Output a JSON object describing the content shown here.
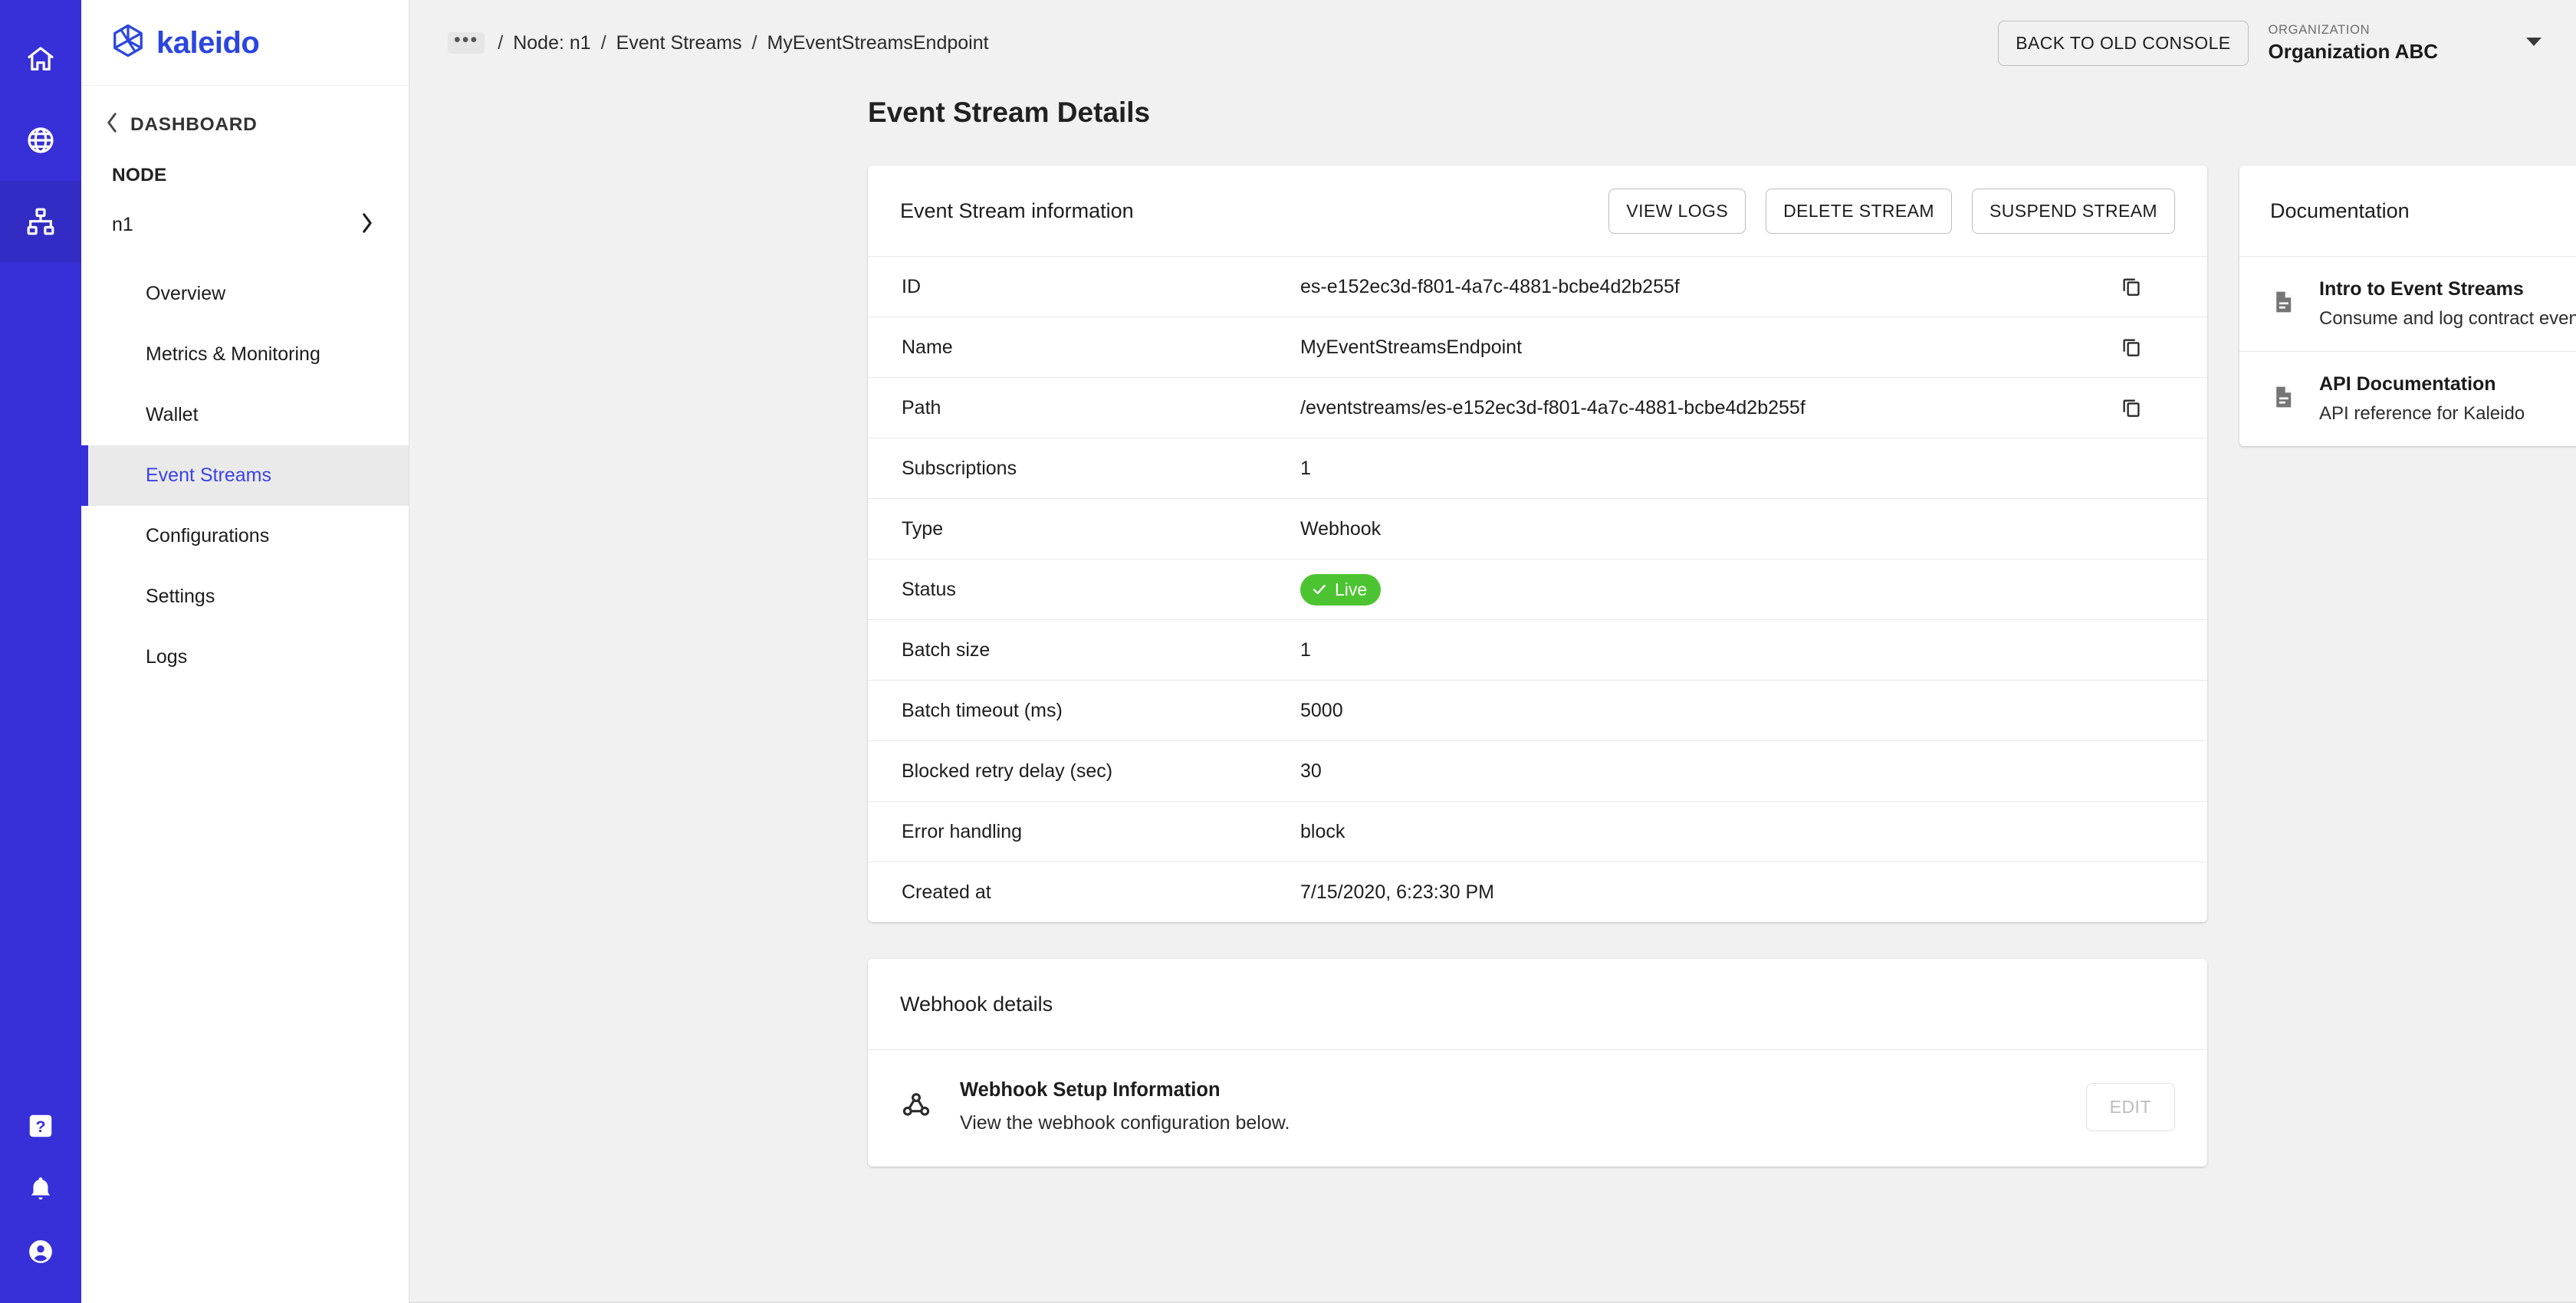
{
  "rail": {
    "items": [
      {
        "icon": "home-icon",
        "name": "rail-item-home",
        "active": false
      },
      {
        "icon": "globe-icon",
        "name": "rail-item-networks",
        "active": false
      },
      {
        "icon": "nodes-icon",
        "name": "rail-item-nodes",
        "active": true
      }
    ],
    "bottom_items": [
      {
        "icon": "help-icon",
        "name": "rail-item-help"
      },
      {
        "icon": "bell-icon",
        "name": "rail-item-notifications"
      },
      {
        "icon": "account-icon",
        "name": "rail-item-account"
      }
    ]
  },
  "brand": {
    "word": "kaleido",
    "color": "#2b46df"
  },
  "sidebar": {
    "dashboard_label": "DASHBOARD",
    "section_label": "NODE",
    "node_name": "n1",
    "items": [
      {
        "label": "Overview",
        "active": false
      },
      {
        "label": "Metrics & Monitoring",
        "active": false
      },
      {
        "label": "Wallet",
        "active": false
      },
      {
        "label": "Event Streams",
        "active": true
      },
      {
        "label": "Configurations",
        "active": false
      },
      {
        "label": "Settings",
        "active": false
      },
      {
        "label": "Logs",
        "active": false
      }
    ]
  },
  "topbar": {
    "breadcrumb": {
      "ellipsis": "•••",
      "separator": "/",
      "items": [
        "Node: n1",
        "Event Streams",
        "MyEventStreamsEndpoint"
      ]
    },
    "back_button_label": "BACK TO OLD CONSOLE",
    "org_caption": "ORGANIZATION",
    "org_name": "Organization ABC"
  },
  "page": {
    "title": "Event Stream Details"
  },
  "info_card": {
    "title": "Event Stream information",
    "actions": [
      {
        "label": "VIEW LOGS",
        "name": "view-logs-button"
      },
      {
        "label": "DELETE STREAM",
        "name": "delete-stream-button"
      },
      {
        "label": "SUSPEND STREAM",
        "name": "suspend-stream-button"
      }
    ],
    "rows": [
      {
        "key": "ID",
        "value": "es-e152ec3d-f801-4a7c-4881-bcbe4d2b255f",
        "copy": true,
        "type": "text"
      },
      {
        "key": "Name",
        "value": "MyEventStreamsEndpoint",
        "copy": true,
        "type": "text"
      },
      {
        "key": "Path",
        "value": "/eventstreams/es-e152ec3d-f801-4a7c-4881-bcbe4d2b255f",
        "copy": true,
        "type": "text"
      },
      {
        "key": "Subscriptions",
        "value": "1",
        "copy": false,
        "type": "text"
      },
      {
        "key": "Type",
        "value": "Webhook",
        "copy": false,
        "type": "text"
      },
      {
        "key": "Status",
        "value": "Live",
        "copy": false,
        "type": "badge"
      },
      {
        "key": "Batch size",
        "value": "1",
        "copy": false,
        "type": "text"
      },
      {
        "key": "Batch timeout (ms)",
        "value": "5000",
        "copy": false,
        "type": "text"
      },
      {
        "key": "Blocked retry delay (sec)",
        "value": "30",
        "copy": false,
        "type": "text"
      },
      {
        "key": "Error handling",
        "value": "block",
        "copy": false,
        "type": "text"
      },
      {
        "key": "Created at",
        "value": "7/15/2020, 6:23:30 PM",
        "copy": false,
        "type": "text"
      }
    ],
    "status_color": "#4cc431"
  },
  "webhook_card": {
    "title": "Webhook details",
    "setup_title": "Webhook Setup Information",
    "setup_sub": "View the webhook configuration below.",
    "edit_label": "EDIT"
  },
  "documentation": {
    "title": "Documentation",
    "items": [
      {
        "title": "Intro to Event Streams",
        "subtitle": "Consume and log contract events"
      },
      {
        "title": "API Documentation",
        "subtitle": "API reference for Kaleido"
      }
    ]
  }
}
